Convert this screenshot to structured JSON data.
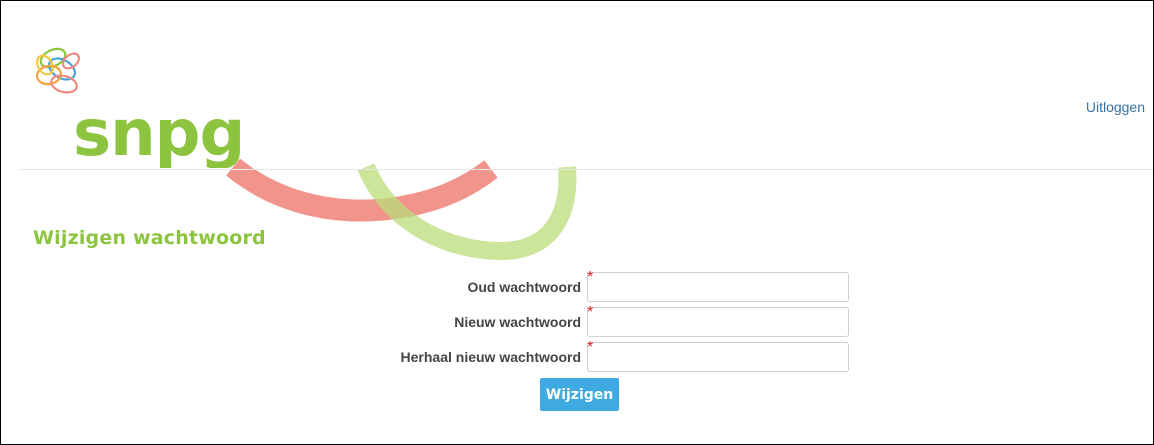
{
  "brand": {
    "name": "snpg",
    "color_primary": "#8cc43f",
    "color_accent_red": "#ef8a80",
    "color_accent_orange": "#f1a23a",
    "color_accent_blue": "#4aa3d8"
  },
  "header": {
    "logout_label": "Uitloggen"
  },
  "page": {
    "title": "Wijzigen wachtwoord"
  },
  "form": {
    "required_marker": "*",
    "fields": [
      {
        "label": "Oud wachtwoord",
        "value": "",
        "placeholder": ""
      },
      {
        "label": "Nieuw wachtwoord",
        "value": "",
        "placeholder": ""
      },
      {
        "label": "Herhaal nieuw wachtwoord",
        "value": "",
        "placeholder": ""
      }
    ],
    "submit_label": "Wijzigen"
  }
}
